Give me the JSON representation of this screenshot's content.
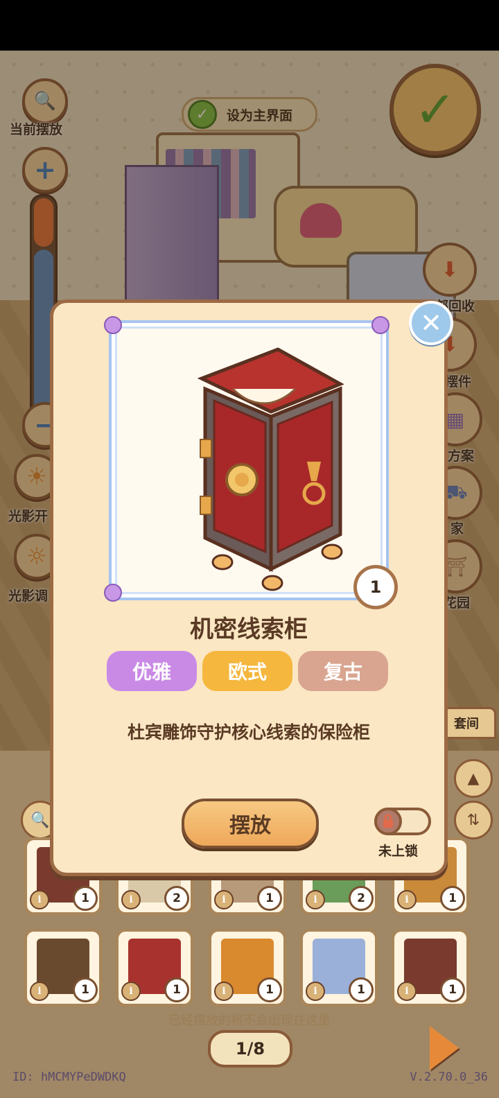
{
  "hud": {
    "current_placement_label": "当前摆放",
    "set_main_label": "设为主界面",
    "lighting_label_1": "光影开",
    "lighting_label_2": "光影调",
    "right_labels": [
      "全部回收",
      "收摆件",
      "方案",
      "搬家",
      "花园"
    ]
  },
  "modal": {
    "item_name": "机密线索柜",
    "quantity": "1",
    "tags": [
      {
        "label": "优雅",
        "color": "#c98ae6"
      },
      {
        "label": "欧式",
        "color": "#f5b73e"
      },
      {
        "label": "复古",
        "color": "#d9a590"
      }
    ],
    "description": "杜宾雕饰守护核心线索的保险柜",
    "place_button": "摆放",
    "lock_label": "未上锁"
  },
  "panel": {
    "suite_tab": "套间",
    "items": [
      {
        "count": "1",
        "art": "#7a3b2e",
        "name": "item-1"
      },
      {
        "count": "2",
        "art": "#d9c9a8",
        "name": "item-2"
      },
      {
        "count": "1",
        "art": "#b79a7a",
        "name": "item-3"
      },
      {
        "count": "2",
        "art": "#6a9c5a",
        "name": "item-4"
      },
      {
        "count": "1",
        "art": "#c98a3a",
        "name": "item-5"
      },
      {
        "count": "1",
        "art": "#6a4a2e",
        "name": "item-6"
      },
      {
        "count": "1",
        "art": "#a8332e",
        "name": "item-7"
      },
      {
        "count": "1",
        "art": "#d98a2e",
        "name": "item-8"
      },
      {
        "count": "1",
        "art": "#9ab0d9",
        "name": "item-9"
      },
      {
        "count": "1",
        "art": "#7a3b2e",
        "name": "item-10"
      }
    ],
    "hint": "已经摆放的将不会出现在这里",
    "page": "1/8"
  },
  "footer": {
    "id": "ID:  hMCMYPeDWDKQ",
    "version": "V.2.70.0_36"
  }
}
